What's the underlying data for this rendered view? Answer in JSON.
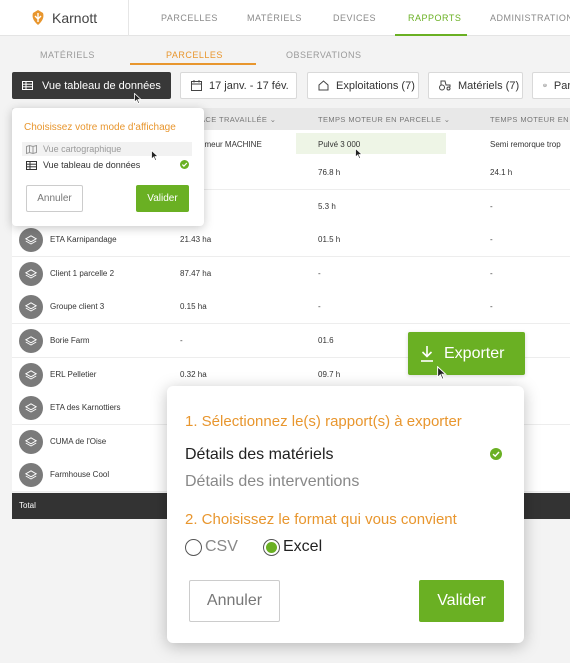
{
  "app": {
    "name": "Karnott"
  },
  "nav": {
    "items": [
      {
        "label": "PARCELLES",
        "active": false
      },
      {
        "label": "MATÉRIELS",
        "active": false
      },
      {
        "label": "DEVICES",
        "active": false
      },
      {
        "label": "RAPPORTS",
        "active": true
      },
      {
        "label": "ADMINISTRATION",
        "active": false
      }
    ]
  },
  "subnav": {
    "items": [
      {
        "label": "MATÉRIELS",
        "active": false
      },
      {
        "label": "PARCELLES",
        "active": true
      },
      {
        "label": "OBSERVATIONS",
        "active": false
      }
    ]
  },
  "toolbar": {
    "view_button": "Vue tableau de données",
    "date_filter": "17 janv. - 17 fév.",
    "exploitations_filter": "Exploitations (7)",
    "materiels_filter": "Matériels (7)",
    "parcelles_filter": "Par"
  },
  "table": {
    "headers": [
      "ACE TRAVAILLÉE",
      "TEMPS MOTEUR EN PARCELLE",
      "TEMPS MOTEUR EN P"
    ],
    "top_cells": {
      "col2": "umeur MACHINE",
      "col3": "Pulvé 3 000",
      "col4": "Semi remorque trop"
    },
    "rows": [
      {
        "name": "",
        "surface": "",
        "moteur": "76.8 h",
        "moteur2": "24.1 h"
      },
      {
        "name": "",
        "surface": "",
        "moteur": "5.3 h",
        "moteur2": "-"
      },
      {
        "name": "ETA Karnipandage",
        "surface": "21.43 ha",
        "moteur": "01.5 h",
        "moteur2": "-"
      },
      {
        "name": "Client 1 parcelle 2",
        "surface": "87.47 ha",
        "moteur": "-",
        "moteur2": "-"
      },
      {
        "name": "Groupe client 3",
        "surface": "0.15 ha",
        "moteur": "-",
        "moteur2": "-"
      },
      {
        "name": "Borie Farm",
        "surface": "-",
        "moteur": "01.6",
        "moteur2": ""
      },
      {
        "name": "ERL Pelletier",
        "surface": "0.32 ha",
        "moteur": "09.7 h",
        "moteur2": ""
      },
      {
        "name": "ETA des Karnottiers",
        "surface": "",
        "moteur": "",
        "moteur2": ""
      },
      {
        "name": "CUMA de l'Oise",
        "surface": "",
        "moteur": "",
        "moteur2": ""
      },
      {
        "name": "Farmhouse Cool",
        "surface": "",
        "moteur": "",
        "moteur2": ""
      }
    ],
    "total_label": "Total"
  },
  "view_popover": {
    "title": "Choisissez votre mode d'affichage",
    "option_map": "Vue cartographique",
    "option_table": "Vue tableau de données",
    "cancel": "Annuler",
    "confirm": "Valider"
  },
  "export": {
    "button": "Exporter",
    "step1": "1. Sélectionnez le(s) rapport(s) à exporter",
    "report_materiels": "Détails des matériels",
    "report_interventions": "Détails des interventions",
    "step2": "2. Choisissez le format qui vous convient",
    "format_csv": "CSV",
    "format_excel": "Excel",
    "selected_format": "Excel",
    "cancel": "Annuler",
    "confirm": "Valider"
  },
  "colors": {
    "green": "#6ab023",
    "orange": "#e8962e",
    "dark": "#383838"
  }
}
